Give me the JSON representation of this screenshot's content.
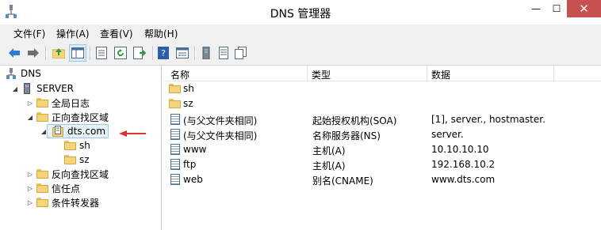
{
  "window": {
    "title": "DNS 管理器",
    "close_glyph": "✕",
    "min_glyph": "—",
    "max_glyph": "☐"
  },
  "menu": [
    "文件(F)",
    "操作(A)",
    "查看(V)",
    "帮助(H)"
  ],
  "toolbar": [
    "back-icon",
    "forward-icon",
    "up-folder-icon",
    "show-tree-icon",
    "properties-icon",
    "refresh-icon",
    "export-icon",
    "help-icon",
    "view-icon",
    "server-icon",
    "list-icon",
    "copy-icon"
  ],
  "tree": {
    "root": "DNS",
    "server": "SERVER",
    "global_logs": "全局日志",
    "forward_zones": "正向查找区域",
    "zone": "dts.com",
    "sub1": "sh",
    "sub2": "sz",
    "reverse_zones": "反向查找区域",
    "trust_points": "信任点",
    "conditional_forwarders": "条件转发器"
  },
  "list": {
    "columns": [
      "名称",
      "类型",
      "数据"
    ],
    "rows": [
      {
        "icon": "folder-icon",
        "name": "sh",
        "type": "",
        "data": ""
      },
      {
        "icon": "folder-icon",
        "name": "sz",
        "type": "",
        "data": ""
      },
      {
        "icon": "record-icon",
        "name": "(与父文件夹相同)",
        "type": "起始授权机构(SOA)",
        "data": "[1], server., hostmaster."
      },
      {
        "icon": "record-icon",
        "name": "(与父文件夹相同)",
        "type": "名称服务器(NS)",
        "data": "server."
      },
      {
        "icon": "record-icon",
        "name": "www",
        "type": "主机(A)",
        "data": "10.10.10.10"
      },
      {
        "icon": "record-icon",
        "name": "ftp",
        "type": "主机(A)",
        "data": "192.168.10.2"
      },
      {
        "icon": "record-icon",
        "name": "web",
        "type": "别名(CNAME)",
        "data": "www.dts.com"
      }
    ]
  },
  "colors": {
    "annotation_arrow": "#e03030",
    "close_button": "#c75050",
    "selection": "#e5f3fb"
  }
}
